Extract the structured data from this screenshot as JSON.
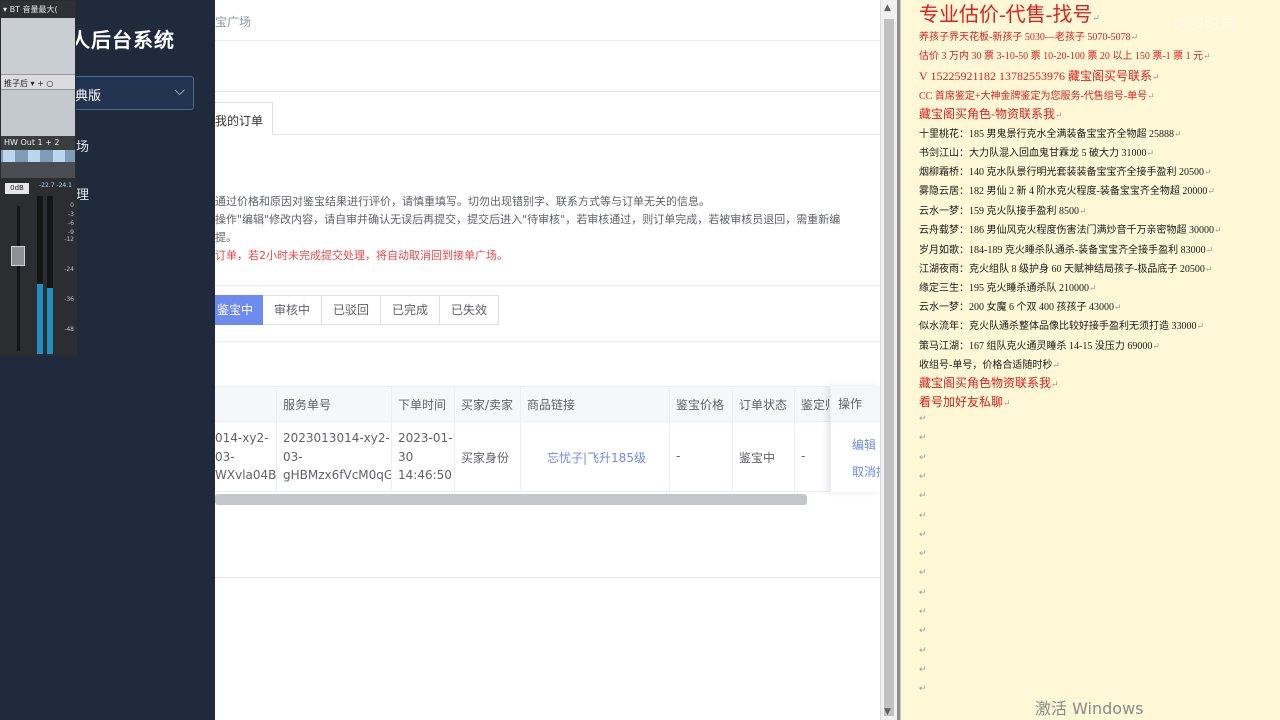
{
  "sidebar": {
    "title": "人后台系统",
    "version_select": "典版",
    "items": [
      "场",
      "理"
    ]
  },
  "mixer": {
    "track": "BT 音量最大(",
    "insert": "推子后 ▾ + ○",
    "output": "HW Out 1 + 2",
    "gain": "0dB",
    "peak": "-22.7 -24.1",
    "scale": [
      "0",
      "-3",
      "-6",
      "-9",
      "-12",
      "-24",
      "-36",
      "-48"
    ]
  },
  "main": {
    "breadcrumb": "宝广场",
    "tab": "我的订单",
    "notes": [
      "通过价格和原因对鉴宝结果进行评价，请慎重填写。切勿出现错别字、联系方式等与订单无关的信息。",
      "操作\"编辑\"修改内容，请自审并确认无误后再提交，提交后进入\"待审核\"，若审核通过，则订单完成，若被审核员退回，需重新编",
      "提。",
      "订单，若2小时未完成提交处理，将自动取消回到接单广场。"
    ],
    "status_tabs": [
      "鉴宝中",
      "审核中",
      "已驳回",
      "已完成",
      "已失效"
    ],
    "table": {
      "headers": [
        "",
        "服务单号",
        "下单时间",
        "买家/卖家",
        "商品链接",
        "鉴宝价格",
        "订单状态",
        "鉴定师"
      ],
      "operation_header": "操作",
      "row": {
        "order_lines": [
          "014-xy2-",
          "03-",
          "WXvla04B"
        ],
        "service_lines": [
          "2023013014-xy2-",
          "03-",
          "gHBMzx6fVcM0qG"
        ],
        "time_lines": [
          "2023-01-",
          "30",
          "14:46:50"
        ],
        "role": "买家身份",
        "link": "忘忧子|飞升185级",
        "price": "-",
        "status": "鉴宝中",
        "appraiser": "-",
        "ops": [
          "编辑",
          "取消接"
        ]
      }
    }
  },
  "doc": {
    "headline": "专业估价-代售-找号",
    "lines": [
      {
        "t": "养孩子界天花板-新孩子 5030—老孩子 5070-5078",
        "cls": "red"
      },
      {
        "t": "估价 3 万内 30 票 3-10-50 票 10-20-100 票 20 以上 150 票-1 票 1 元",
        "cls": "red"
      },
      {
        "t": "V 15225921182     13782553976   藏宝阁买号联系",
        "cls": "red m"
      },
      {
        "t": "CC 首席鉴定+大神金牌鉴定为您服务-代售组号-单号",
        "cls": "red"
      },
      {
        "t": "藏宝阁买角色-物资联系我",
        "cls": "red m"
      },
      {
        "t": "十里桃花：185 男鬼景行克水全满装备宝宝齐全物超 25888",
        "cls": ""
      },
      {
        "t": "书剑江山：大力队混入回血鬼甘霖龙 5 破大力 31000",
        "cls": ""
      },
      {
        "t": "烟柳霜桥：140 克水队景行明光套装装备宝宝齐全接手盈利 20500",
        "cls": ""
      },
      {
        "t": "雾隐云居：182 男仙 2 新 4 阶水克火程度-装备宝宝齐全物超 20000",
        "cls": ""
      },
      {
        "t": "云水一梦：159 克火队接手盈利 8500",
        "cls": ""
      },
      {
        "t": "云舟载梦：186 男仙风克火程度伤害法门满炒音千万亲密物超 30000",
        "cls": ""
      },
      {
        "t": "岁月如歌：184-189 克火睡杀队通杀-装备宝宝齐全接手盈利 83000",
        "cls": ""
      },
      {
        "t": "江湖夜雨：克火组队 8 级护身 60 天赋神结局孩子-极品底子 20500",
        "cls": ""
      },
      {
        "t": "缘定三生：195 克火睡杀通杀队 210000",
        "cls": ""
      },
      {
        "t": "云水一梦：200 女魔 6 个双 400 孩孩子 43000",
        "cls": ""
      },
      {
        "t": "似水流年：克火队通杀整体品像比较好接手盈利无须打造 33000",
        "cls": ""
      },
      {
        "t": "策马江湖：167 组队克火通灵睡杀 14-15 没压力 69000",
        "cls": ""
      },
      {
        "t": "收组号-单号，价格合适随时秒",
        "cls": ""
      },
      {
        "t": "藏宝阁买角色物资联系我",
        "cls": "red m"
      },
      {
        "t": "看号加好友私聊",
        "cls": "red m"
      }
    ],
    "para_mark": "↵",
    "watermark": "⊙ 实时通",
    "activate": "激活 Windows"
  }
}
